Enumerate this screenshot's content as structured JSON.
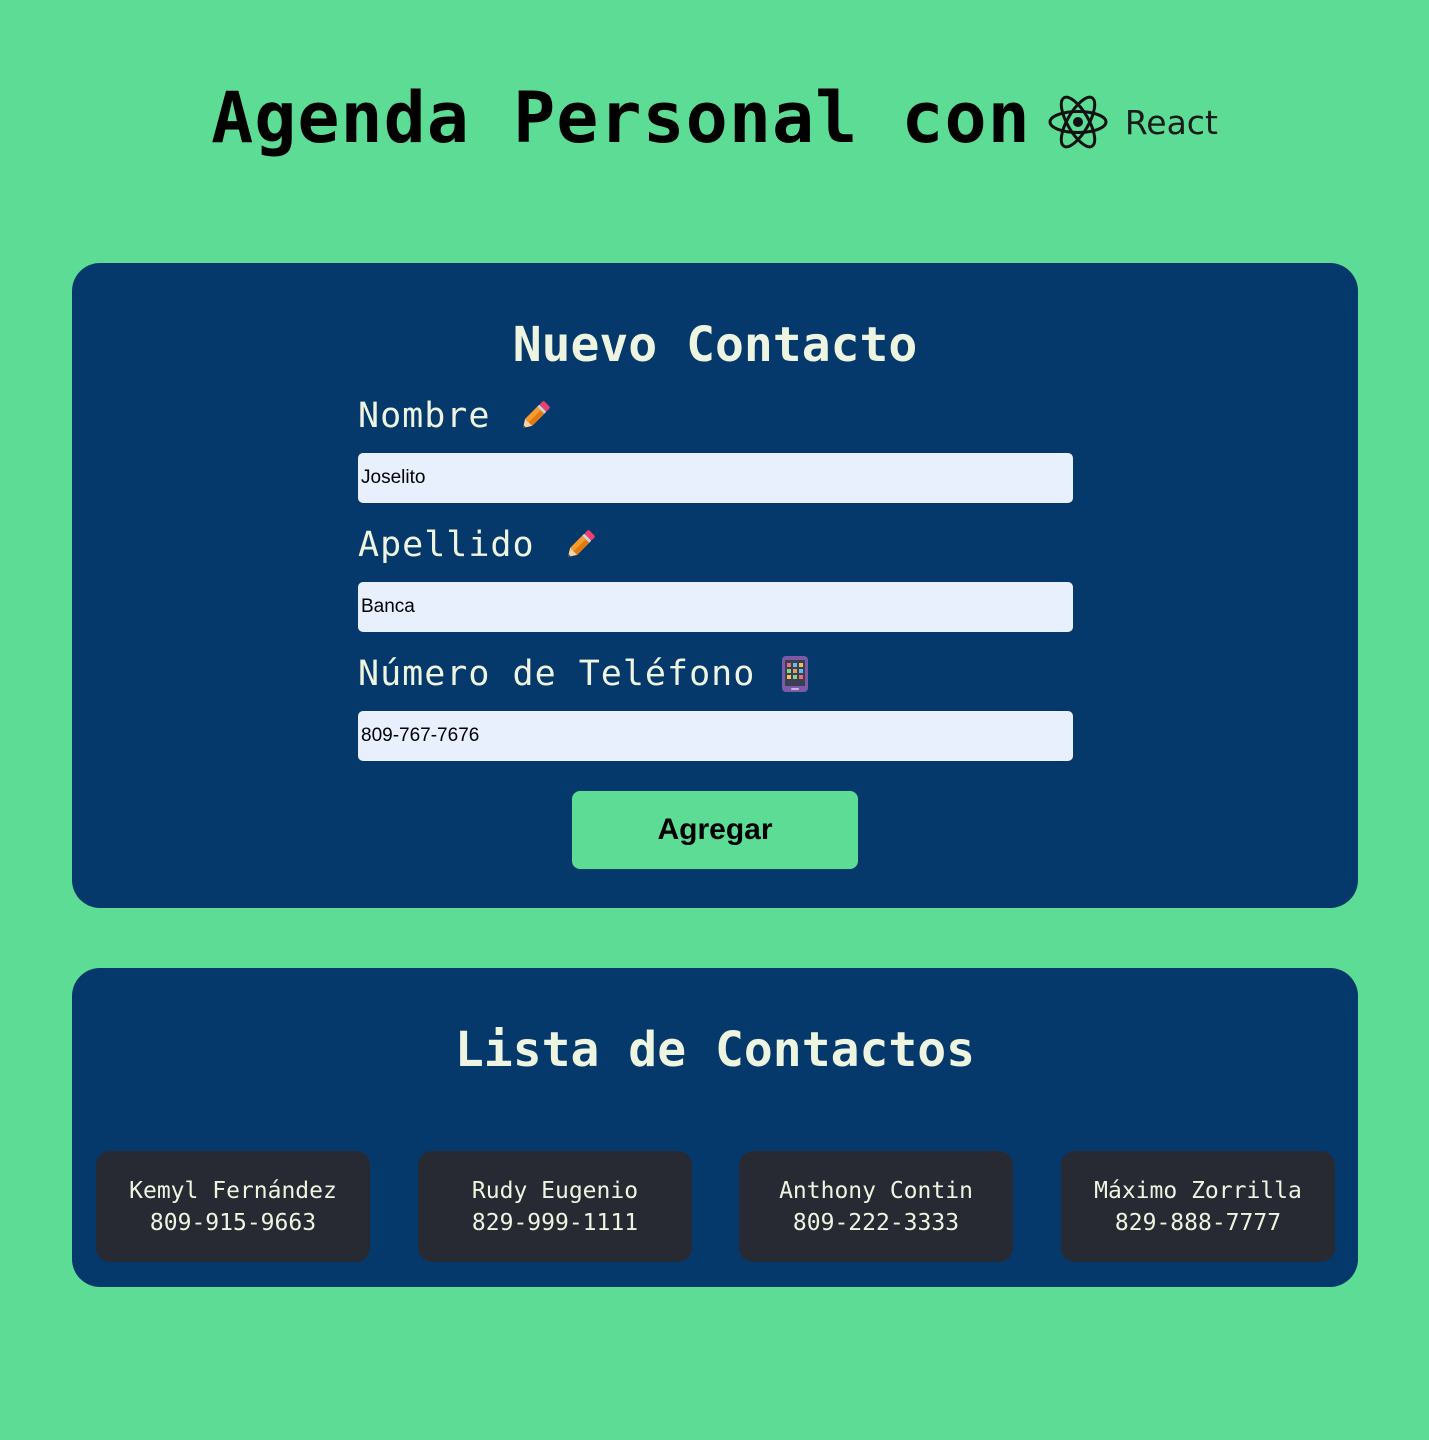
{
  "header": {
    "title": "Agenda Personal con",
    "logo_text": "React"
  },
  "form": {
    "title": "Nuevo Contacto",
    "fields": [
      {
        "label": "Nombre",
        "icon": "pencil-icon",
        "value": "Joselito"
      },
      {
        "label": "Apellido",
        "icon": "pencil-icon",
        "value": "Banca"
      },
      {
        "label": "Número de Teléfono",
        "icon": "mobile-phone-icon",
        "value": "809-767-7676"
      }
    ],
    "submit_label": "Agregar"
  },
  "list": {
    "title": "Lista de Contactos",
    "contacts": [
      {
        "name": "Kemyl Fernández",
        "phone": "809-915-9663"
      },
      {
        "name": "Rudy Eugenio",
        "phone": "829-999-1111"
      },
      {
        "name": "Anthony Contin",
        "phone": "809-222-3333"
      },
      {
        "name": "Máximo Zorrilla",
        "phone": "829-888-7777"
      }
    ]
  },
  "colors": {
    "background": "#5cdc94",
    "panel": "#05386b",
    "card": "#282a33",
    "light_text": "#edf5e1",
    "input_bg": "#e8f0fe"
  }
}
